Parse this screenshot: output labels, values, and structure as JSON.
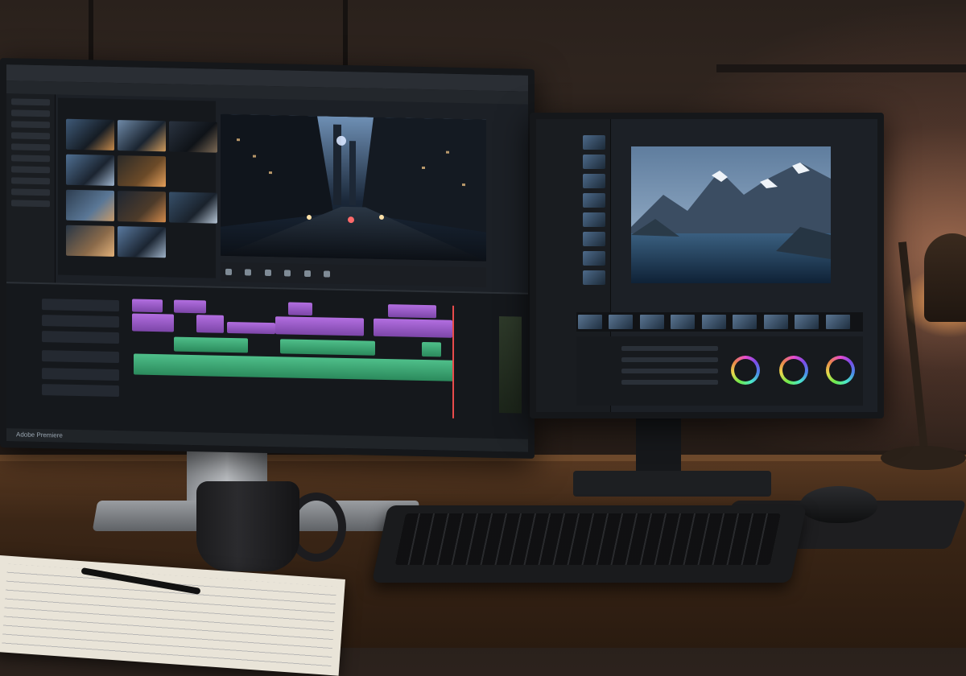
{
  "scene": {
    "description_ui_left": "video editing application with media bin, viewer and multi-track timeline",
    "description_ui_right": "color grading panel with landscape viewer, filmstrip and three color wheels"
  },
  "left_monitor": {
    "statusbar_text": "Adobe Premiere"
  },
  "colors": {
    "video_clip": "#b26ee0",
    "audio_clip": "#4fbf8a",
    "playhead": "#e84b4b",
    "lamp_glow": "#ffd9a0"
  },
  "icons": [
    "play-icon",
    "stop-icon",
    "step-back-icon",
    "step-forward-icon",
    "color-wheel-icon"
  ]
}
